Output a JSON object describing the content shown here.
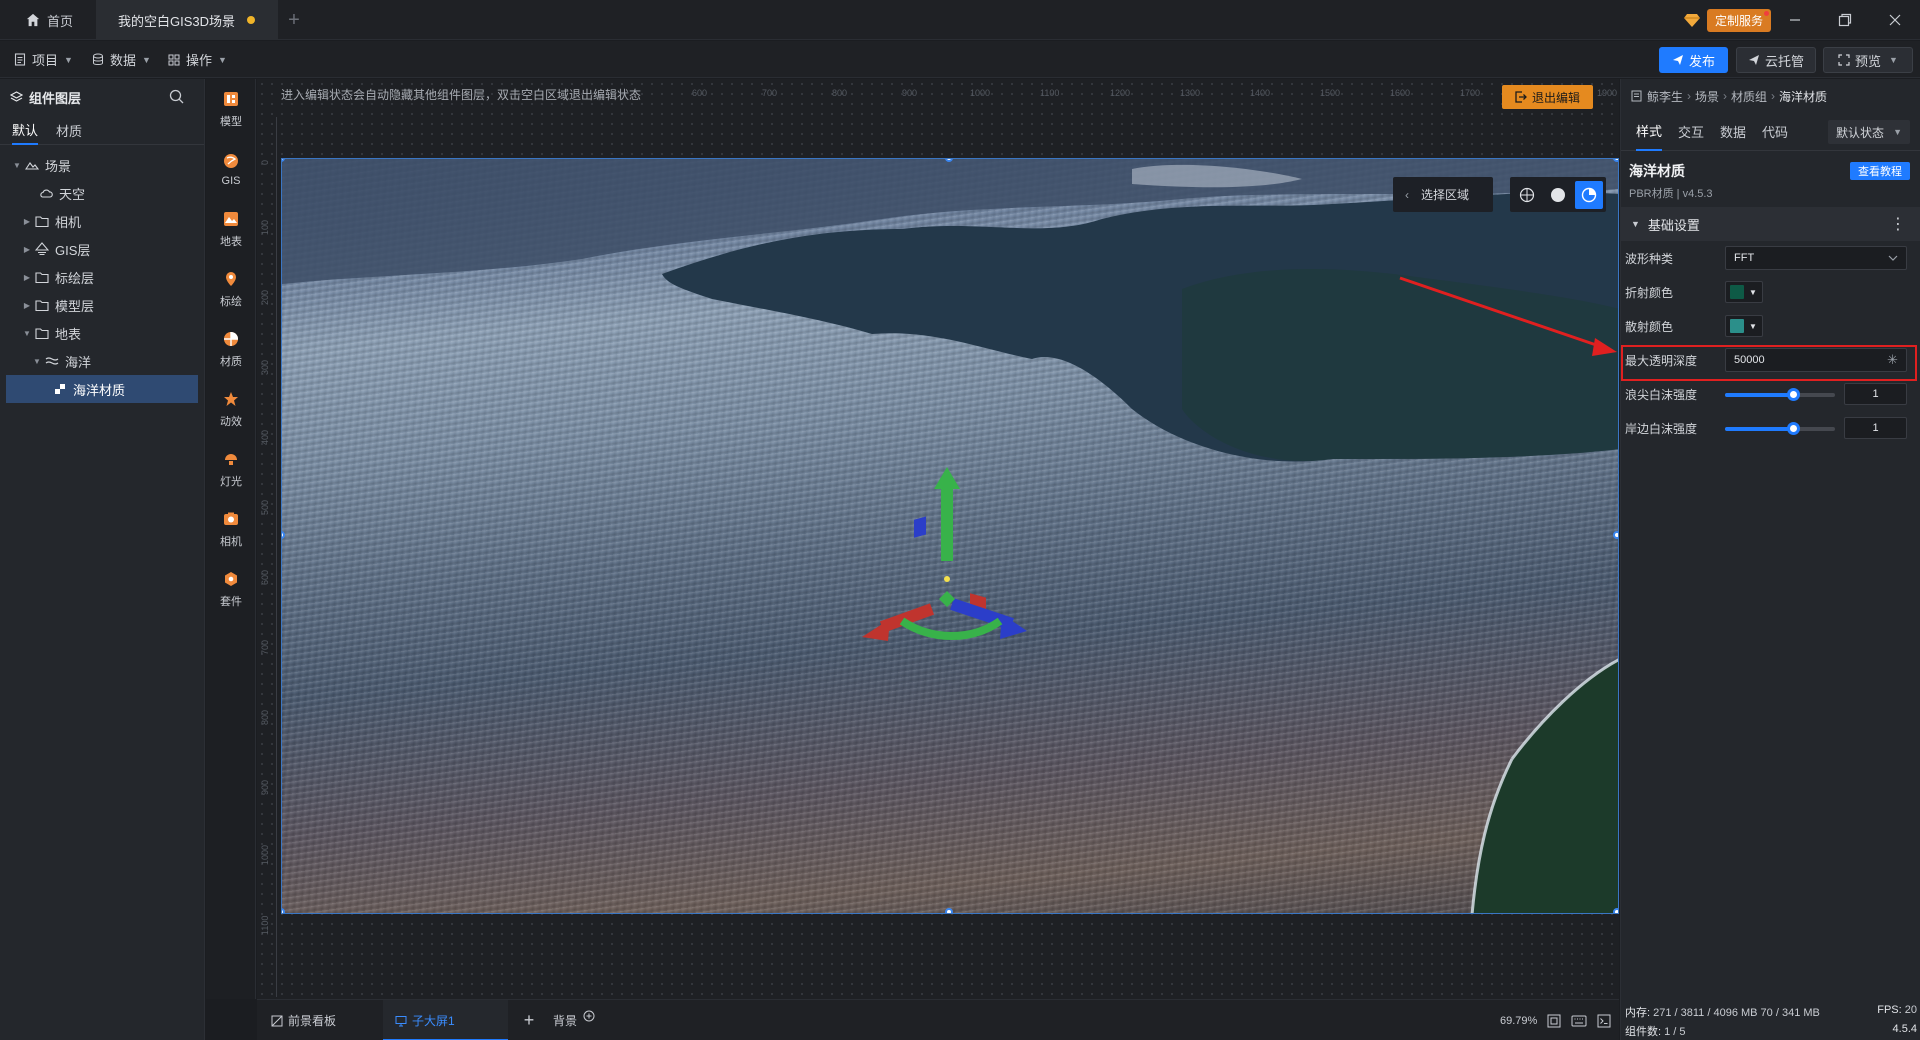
{
  "titlebar": {
    "home_tab": "首页",
    "scene_tab": "我的空白GIS3D场景",
    "custom_service": "定制服务",
    "unsaved_color": "#f0b429"
  },
  "menubar": {
    "project": "项目",
    "data": "数据",
    "operate": "操作",
    "publish": "发布",
    "cloud": "云托管",
    "preview": "预览"
  },
  "layers": {
    "title": "组件图层",
    "tabs": [
      "默认",
      "材质"
    ],
    "tree": [
      {
        "label": "场景",
        "depth": 0,
        "expanded": true,
        "icon": "scene-icon"
      },
      {
        "label": "天空",
        "depth": 1,
        "icon": "sky-icon"
      },
      {
        "label": "相机",
        "depth": 1,
        "collapsed": true,
        "icon": "folder-icon"
      },
      {
        "label": "GIS层",
        "depth": 1,
        "collapsed": true,
        "icon": "gis-layer-icon"
      },
      {
        "label": "标绘层",
        "depth": 1,
        "collapsed": true,
        "icon": "folder-icon"
      },
      {
        "label": "模型层",
        "depth": 1,
        "collapsed": true,
        "icon": "folder-icon"
      },
      {
        "label": "地表",
        "depth": 1,
        "expanded": true,
        "icon": "folder-icon"
      },
      {
        "label": "海洋",
        "depth": 2,
        "expanded": true,
        "icon": "ocean-icon"
      },
      {
        "label": "海洋材质",
        "depth": 3,
        "selected": true,
        "icon": "material-icon"
      }
    ]
  },
  "toolbar": {
    "items": [
      "模型",
      "GIS",
      "地表",
      "标绘",
      "材质",
      "动效",
      "灯光",
      "相机",
      "套件"
    ]
  },
  "canvas": {
    "hint": "进入编辑状态会自动隐藏其他组件图层，双击空白区域退出编辑状态",
    "exit_edit": "退出编辑",
    "select_region": "选择区域",
    "ruler_top": [
      "600",
      "700",
      "800",
      "900",
      "1000",
      "1100",
      "1200",
      "1300",
      "1400",
      "1500",
      "1600",
      "1700",
      "1800",
      "1900"
    ],
    "ruler_left": [
      "0",
      "100",
      "200",
      "300",
      "400",
      "500",
      "600",
      "700",
      "800",
      "900",
      "1000",
      "1100"
    ]
  },
  "bottom": {
    "tab_foreground": "前景看板",
    "tab_sub": "子大屏1",
    "tab_background": "背景",
    "zoom": "69.79%"
  },
  "rpanel": {
    "breadcrumb": [
      "鲸李生",
      "场景",
      "材质组",
      "海洋材质"
    ],
    "tabs": [
      "样式",
      "交互",
      "数据",
      "代码"
    ],
    "state": "默认状态",
    "component_name": "海洋材质",
    "component_version": "PBR材质 | v4.5.3",
    "tutorial": "查看教程",
    "section": "基础设置",
    "props": {
      "wave_type_label": "波形种类",
      "wave_type_value": "FFT",
      "refraction_label": "折射颜色",
      "refraction_color": "#0e5a46",
      "scatter_label": "散射颜色",
      "scatter_color": "#2b8f8a",
      "max_depth_label": "最大透明深度",
      "max_depth_value": "50000",
      "crest_foam_label": "浪尖白沫强度",
      "crest_foam_value": "1",
      "crest_foam_level": 0.62,
      "shore_foam_label": "岸边白沫强度",
      "shore_foam_value": "1",
      "shore_foam_level": 0.62
    },
    "status": {
      "memory_label": "内存:",
      "memory_value": "271 / 3811 / 4096 MB  70 / 341 MB",
      "fps_label": "FPS:",
      "fps_value": "20",
      "components_label": "组件数:",
      "components_value": "1 / 5",
      "version": "4.5.4"
    }
  },
  "colors": {
    "accent": "#1f7bff",
    "warning": "#e58a1f",
    "highlight_box": "#e02020"
  }
}
